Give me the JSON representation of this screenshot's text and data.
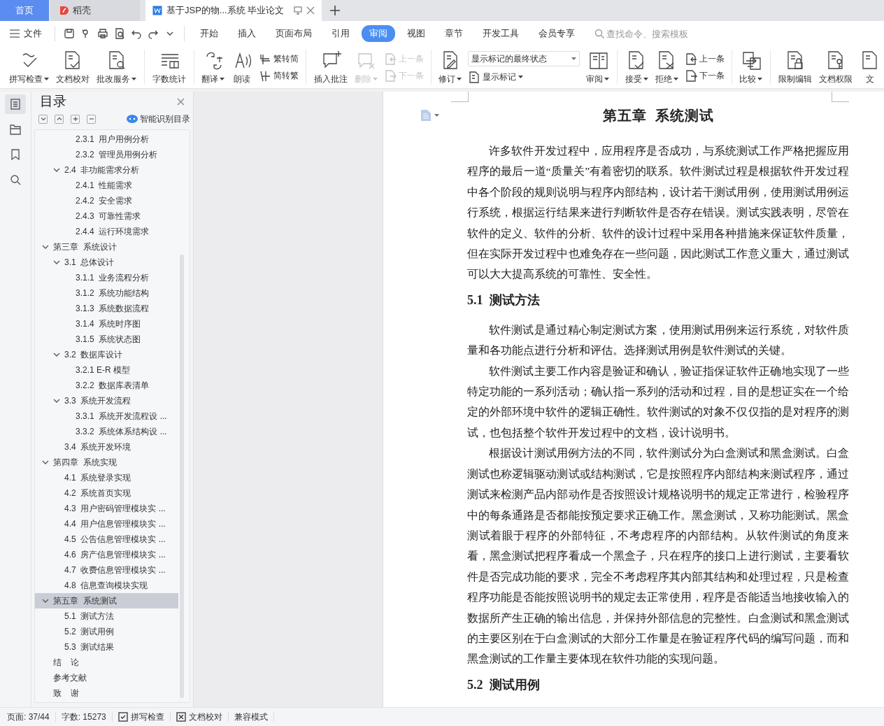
{
  "browser_tabs": [
    {
      "label": "首页",
      "kind": "home",
      "selected": false
    },
    {
      "label": "稻壳",
      "kind": "app",
      "selected": false
    },
    {
      "label": "基于JSP的物...系统 毕业论文",
      "kind": "doc",
      "selected": true
    }
  ],
  "menu": {
    "file": "文件",
    "tabs": [
      {
        "label": "开始",
        "selected": false
      },
      {
        "label": "插入",
        "selected": false
      },
      {
        "label": "页面布局",
        "selected": false
      },
      {
        "label": "引用",
        "selected": false
      },
      {
        "label": "审阅",
        "selected": true
      },
      {
        "label": "视图",
        "selected": false
      },
      {
        "label": "章节",
        "selected": false
      },
      {
        "label": "开发工具",
        "selected": false
      },
      {
        "label": "会员专享",
        "selected": false
      }
    ],
    "search_placeholder": "查找命令、搜索模板"
  },
  "ribbon": [
    {
      "kind": "button",
      "label": "拼写检查",
      "menu": true,
      "disabled": false
    },
    {
      "kind": "button",
      "label": "文档校对",
      "menu": false,
      "disabled": false
    },
    {
      "kind": "button",
      "label": "批改服务",
      "menu": true,
      "disabled": false
    },
    {
      "kind": "separator"
    },
    {
      "kind": "button",
      "label": "字数统计",
      "menu": false,
      "disabled": false
    },
    {
      "kind": "separator"
    },
    {
      "kind": "button",
      "label": "翻译",
      "menu": true,
      "disabled": false
    },
    {
      "kind": "button",
      "label": "朗读",
      "menu": false,
      "disabled": false
    },
    {
      "kind": "pair",
      "items": [
        {
          "label": "繁转简",
          "disabled": false
        },
        {
          "label": "简转繁",
          "disabled": false
        }
      ]
    },
    {
      "kind": "separator"
    },
    {
      "kind": "button",
      "label": "插入批注",
      "menu": false,
      "disabled": false
    },
    {
      "kind": "button",
      "label": "删除",
      "menu": true,
      "disabled": true
    },
    {
      "kind": "pair",
      "items": [
        {
          "label": "上一条",
          "disabled": true
        },
        {
          "label": "下一条",
          "disabled": true
        }
      ]
    },
    {
      "kind": "separator"
    },
    {
      "kind": "button",
      "label": "修订",
      "menu": true,
      "disabled": false
    },
    {
      "kind": "select",
      "value": "显示标记的最终状态",
      "below": "显示标记"
    },
    {
      "kind": "button",
      "label": "审阅",
      "menu": true,
      "disabled": false
    },
    {
      "kind": "separator"
    },
    {
      "kind": "button",
      "label": "接受",
      "menu": true,
      "disabled": false
    },
    {
      "kind": "button",
      "label": "拒绝",
      "menu": true,
      "disabled": false
    },
    {
      "kind": "pair",
      "items": [
        {
          "label": "上一条",
          "disabled": false
        },
        {
          "label": "下一条",
          "disabled": false
        }
      ]
    },
    {
      "kind": "separator"
    },
    {
      "kind": "button",
      "label": "比较",
      "menu": true,
      "disabled": false
    },
    {
      "kind": "separator"
    },
    {
      "kind": "button",
      "label": "限制编辑",
      "menu": false,
      "disabled": false
    },
    {
      "kind": "button",
      "label": "文档权限",
      "menu": false,
      "disabled": false
    },
    {
      "kind": "button",
      "label": "文",
      "menu": false,
      "disabled": false
    }
  ],
  "toc": {
    "title": "目录",
    "smart_button": "智能识别目录",
    "tree": [
      {
        "children": [
          {
            "children": [
              {
                "label": "2.3.1  用户用例分析",
                "selected": false
              },
              {
                "label": "2.3.2  管理员用例分析",
                "selected": false
              }
            ]
          },
          {
            "label": "2.4  非功能需求分析",
            "selected": false,
            "expanded": true,
            "children": [
              {
                "label": "2.4.1  性能需求",
                "selected": false
              },
              {
                "label": "2.4.2  安全需求",
                "selected": false
              },
              {
                "label": "2.4.3  可靠性需求",
                "selected": false
              },
              {
                "label": "2.4.4  运行环境需求",
                "selected": false
              }
            ]
          }
        ]
      },
      {
        "label": "第三章  系统设计",
        "selected": false,
        "expanded": true,
        "children": [
          {
            "label": "3.1  总体设计",
            "selected": false,
            "expanded": true,
            "children": [
              {
                "label": "3.1.1  业务流程分析",
                "selected": false
              },
              {
                "label": "3.1.2  系统功能结构",
                "selected": false
              },
              {
                "label": "3.1.3  系统数据流程",
                "selected": false
              },
              {
                "label": "3.1.4  系统时序图",
                "selected": false
              },
              {
                "label": "3.1.5  系统状态图",
                "selected": false
              }
            ]
          },
          {
            "label": "3.2  数据库设计",
            "selected": false,
            "expanded": true,
            "children": [
              {
                "label": "3.2.1 E-R 模型",
                "selected": false
              },
              {
                "label": "3.2.2  数据库表清单",
                "selected": false
              }
            ]
          },
          {
            "label": "3.3  系统开发流程",
            "selected": false,
            "expanded": true,
            "children": [
              {
                "label": "3.3.1  系统开发流程设 ...",
                "selected": false
              },
              {
                "label": "3.3.2  系统体系结构设 ...",
                "selected": false
              }
            ]
          },
          {
            "label": "3.4  系统开发环境",
            "selected": false
          }
        ]
      },
      {
        "label": "第四章  系统实现",
        "selected": false,
        "expanded": true,
        "children": [
          {
            "label": "4.1  系统登录实现",
            "selected": false
          },
          {
            "label": "4.2  系统首页实现",
            "selected": false
          },
          {
            "label": "4.3  用户密码管理模块实 ...",
            "selected": false
          },
          {
            "label": "4.4  用户信息管理模块实 ...",
            "selected": false
          },
          {
            "label": "4.5  公告信息管理模块实 ...",
            "selected": false
          },
          {
            "label": "4.6  房产信息管理模块实 ...",
            "selected": false
          },
          {
            "label": "4.7  收费信息管理模块实 ...",
            "selected": false
          },
          {
            "label": "4.8  信息查询模块实现",
            "selected": false
          }
        ]
      },
      {
        "label": "第五章  系统测试",
        "selected": true,
        "expanded": true,
        "children": [
          {
            "label": "5.1  测试方法",
            "selected": false
          },
          {
            "label": "5.2  测试用例",
            "selected": false
          },
          {
            "label": "5.3  测试结果",
            "selected": false
          }
        ]
      },
      {
        "label": "结    论",
        "selected": false
      },
      {
        "label": "参考文献",
        "selected": false
      },
      {
        "label": "致    谢",
        "selected": false
      }
    ]
  },
  "document": {
    "blocks": [
      {
        "kind": "title",
        "text": "第五章  系统测试"
      },
      {
        "kind": "paragraph",
        "text": "许多软件开发过程中，应用程序是否成功，与系统测试工作严格把握应用程序的最后一道“质量关”有着密切的联系。软件测试过程是根据软件开发过程中各个阶段的规则说明与程序内部结构，设计若干测试用例，使用测试用例运行系统，根据运行结果来进行判断软件是否存在错误。测试实践表明，尽管在软件的定义、软件的分析、软件的设计过程中采用各种措施来保证软件质量，但在实际开发过程中也难免存在一些问题，因此测试工作意义重大，通过测试可以大大提高系统的可靠性、安全性。"
      },
      {
        "kind": "heading",
        "text": "5.1  测试方法"
      },
      {
        "kind": "paragraph",
        "text": "软件测试是通过精心制定测试方案，使用测试用例来运行系统，对软件质量和各功能点进行分析和评估。选择测试用例是软件测试的关键。"
      },
      {
        "kind": "paragraph",
        "text": "软件测试主要工作内容是验证和确认，验证指保证软件正确地实现了一些特定功能的一系列活动；确认指一系列的活动和过程，目的是想证实在一个给定的外部环境中软件的逻辑正确性。软件测试的对象不仅仅指的是对程序的测试，也包括整个软件开发过程中的文档，设计说明书。"
      },
      {
        "kind": "paragraph",
        "text": "根据设计测试用例方法的不同，软件测试分为白盒测试和黑盒测试。白盒测试也称逻辑驱动测试或结构测试，它是按照程序内部结构来测试程序，通过测试来检测产品内部动作是否按照设计规格说明书的规定正常进行，检验程序中的每条通路是否都能按预定要求正确工作。黑盒测试，又称功能测试。黑盒测试着眼于程序的外部特征，不考虑程序的内部结构。从软件测试的角度来看，黑盒测试把程序看成一个黑盒子，只在程序的接口上进行测试，主要看软件是否完成功能的要求，完全不考虑程序其内部其结构和处理过程，只是检查程序功能是否能按照说明书的规定去正常使用，程序是否能适当地接收输入的数据所产生正确的输出信息，并保持外部信息的完整性。白盒测试和黑盒测试的主要区别在于白盒测试的大部分工作量是在验证程序代码的编写问题，而和黑盒测试的工作量主要体现在软件功能的实现问题。"
      },
      {
        "kind": "heading",
        "text": "5.2  测试用例"
      }
    ]
  },
  "status_bar": [
    {
      "kind": "text",
      "label": "页面: 37/44"
    },
    {
      "kind": "text",
      "label": "字数: 15273"
    },
    {
      "kind": "check",
      "label": "拼写检查"
    },
    {
      "kind": "cross",
      "label": "文档校对"
    },
    {
      "kind": "text",
      "label": "兼容模式"
    }
  ]
}
